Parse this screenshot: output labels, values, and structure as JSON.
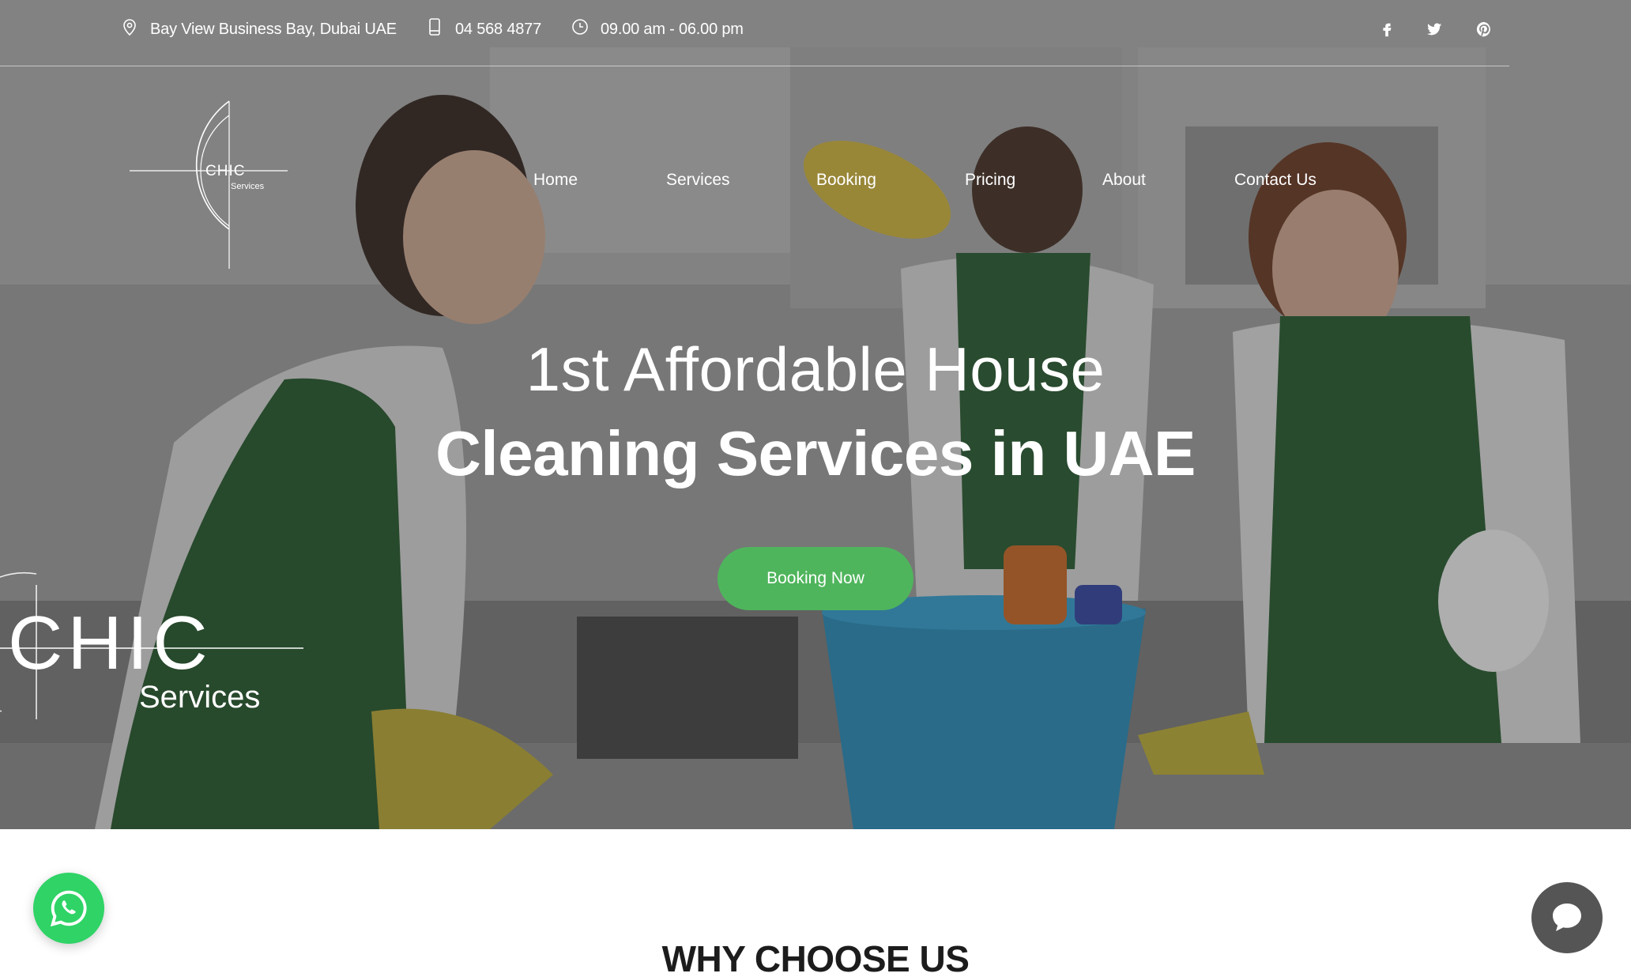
{
  "topbar": {
    "address": "Bay View Business Bay, Dubai UAE",
    "phone": "04 568 4877",
    "hours": "09.00 am - 06.00 pm",
    "address_icon": "map-pin-icon",
    "phone_icon": "phone-icon",
    "hours_icon": "clock-icon",
    "social": [
      "facebook-icon",
      "twitter-icon",
      "pinterest-icon"
    ]
  },
  "logo": {
    "name": "CHIC",
    "tagline": "Services"
  },
  "nav": {
    "items": [
      "Home",
      "Services",
      "Booking",
      "Pricing",
      "About",
      "Contact Us"
    ]
  },
  "hero": {
    "line1": "1st Affordable House",
    "line2": "Cleaning Services in UAE",
    "cta": "Booking Now"
  },
  "watermark": {
    "name": "CHIC",
    "tagline": "Services"
  },
  "section": {
    "title": "WHY CHOOSE US"
  },
  "colors": {
    "accent": "#4fb55c",
    "whatsapp": "#2fd366",
    "chat": "#555555"
  }
}
